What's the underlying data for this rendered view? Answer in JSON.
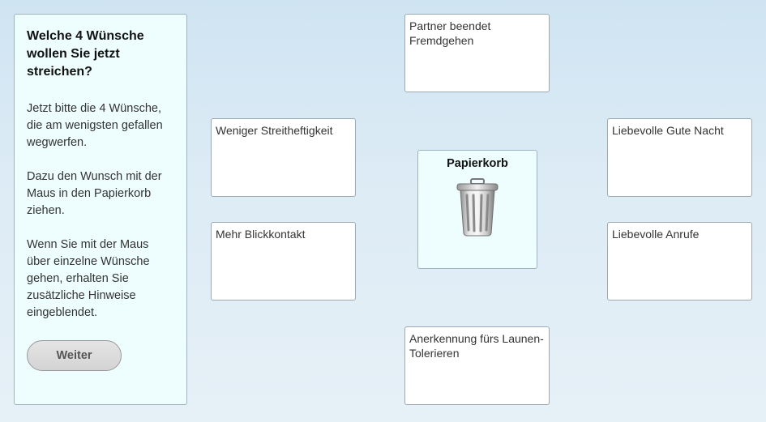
{
  "instructions": {
    "title": "Welche 4 Wünsche wollen Sie jetzt streichen?",
    "paragraph1": "Jetzt bitte die 4 Wünsche, die am wenigsten gefallen wegwerfen.",
    "paragraph2": "Dazu den Wunsch mit der Maus in den Papierkorb ziehen.",
    "paragraph3": "Wenn Sie mit der Maus über einzelne Wünsche gehen, erhalten Sie zusätzliche Hinweise eingeblendet.",
    "button_label": "Weiter"
  },
  "trash": {
    "label": "Papierkorb",
    "icon": "trash-can-icon"
  },
  "wishes": [
    {
      "id": "top",
      "label": "Partner beendet Fremdgehen"
    },
    {
      "id": "left-upper",
      "label": "Weniger Streitheftigkeit"
    },
    {
      "id": "right-upper",
      "label": "Liebevolle Gute Nacht"
    },
    {
      "id": "left-lower",
      "label": "Mehr Blickkontakt"
    },
    {
      "id": "right-lower",
      "label": "Liebevolle Anrufe"
    },
    {
      "id": "bottom",
      "label": "Anerkennung fürs Launen-Tolerieren"
    }
  ]
}
